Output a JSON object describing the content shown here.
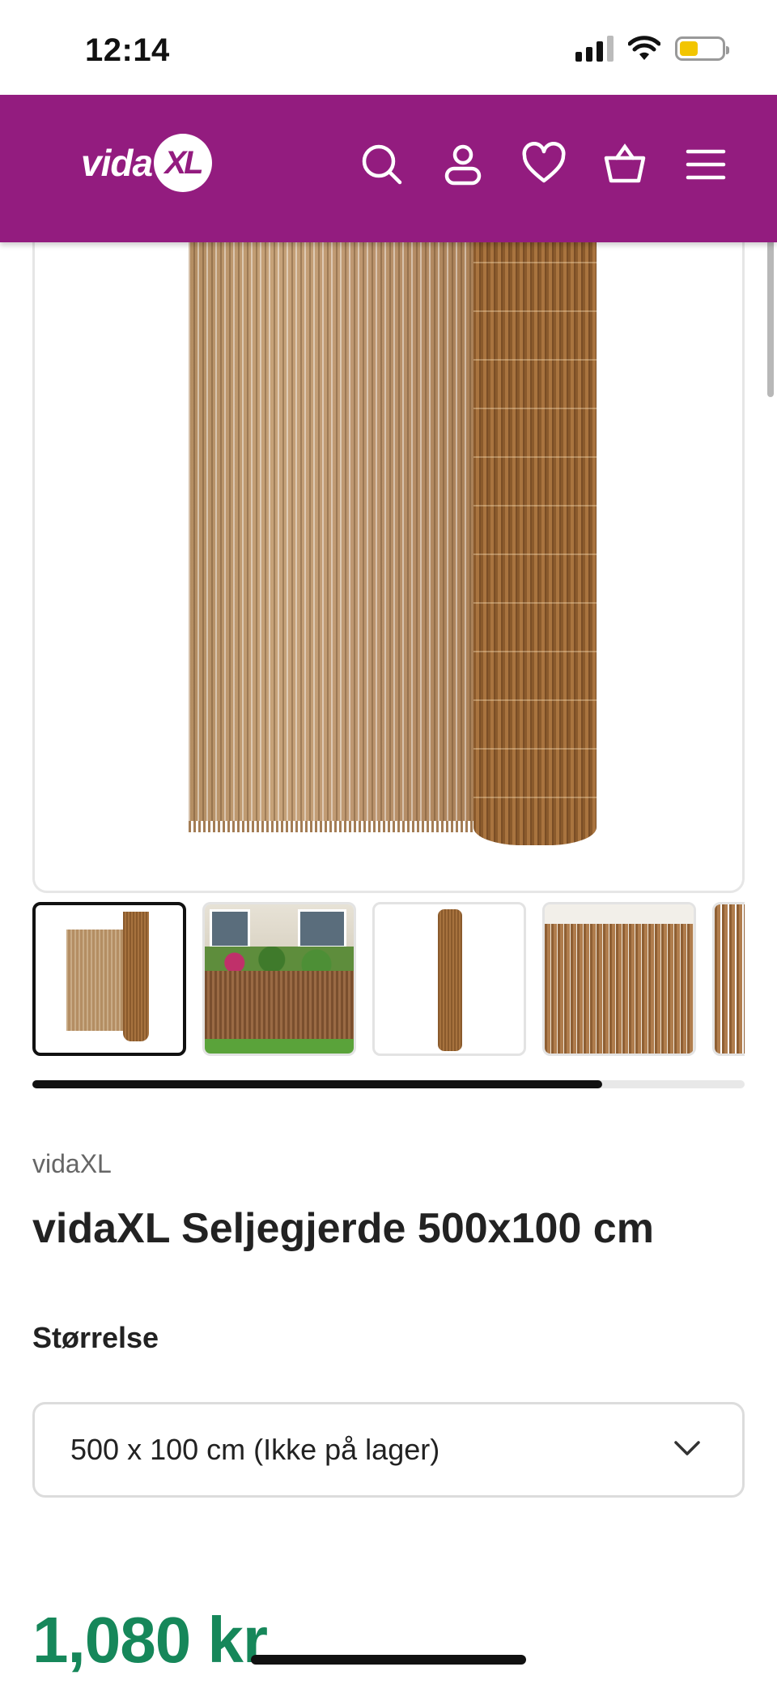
{
  "status_bar": {
    "time": "12:14",
    "battery_level": 0.44
  },
  "header": {
    "logo_text": "vida",
    "logo_badge": "XL",
    "background_color": "#931c7f",
    "icons": [
      "search-icon",
      "account-icon",
      "wishlist-heart-icon",
      "basket-icon",
      "menu-icon"
    ]
  },
  "gallery": {
    "thumbnails": [
      {
        "name": "thumbnail-roll-front",
        "active": true
      },
      {
        "name": "thumbnail-garden-fence",
        "active": false
      },
      {
        "name": "thumbnail-rolled-up",
        "active": false
      },
      {
        "name": "thumbnail-closeup",
        "active": false
      },
      {
        "name": "thumbnail-partial",
        "active": false
      }
    ],
    "scroll_progress": 0.8
  },
  "product": {
    "brand": "vidaXL",
    "title": "vidaXL Seljegjerde 500x100 cm",
    "size_label": "Størrelse",
    "size_selected": "500 x 100 cm (Ikke på lager)",
    "price": "1,080 kr",
    "price_color": "#16875a"
  }
}
